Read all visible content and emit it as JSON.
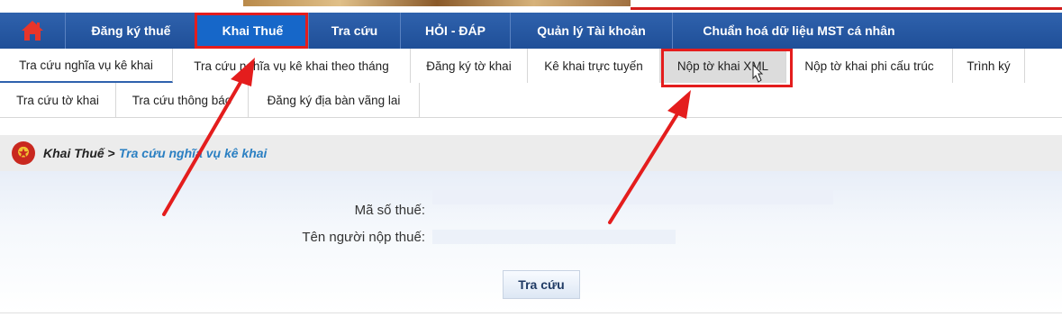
{
  "top_nav": {
    "home_icon": "home-icon",
    "items": [
      {
        "label": "Đăng ký thuế"
      },
      {
        "label": "Khai Thuế"
      },
      {
        "label": "Tra cứu"
      },
      {
        "label": "HỎI - ĐÁP"
      },
      {
        "label": "Quản lý Tài khoản"
      },
      {
        "label": "Chuẩn hoá dữ liệu MST cá nhân"
      }
    ],
    "active_index": 1
  },
  "sub_nav": {
    "row1": [
      {
        "label": "Tra cứu nghĩa vụ kê khai"
      },
      {
        "label": "Tra cứu nghĩa vụ kê khai theo tháng"
      },
      {
        "label": "Đăng ký tờ khai"
      },
      {
        "label": "Kê khai trực tuyến"
      },
      {
        "label": "Nộp tờ khai XML"
      },
      {
        "label": "Nộp tờ khai phi cấu trúc"
      },
      {
        "label": "Trình ký"
      }
    ],
    "row2": [
      {
        "label": "Tra cứu tờ khai"
      },
      {
        "label": "Tra cứu thông báo"
      },
      {
        "label": "Đăng ký địa bàn vãng lai"
      }
    ]
  },
  "breadcrumb": {
    "root": "Khai Thuế",
    "separator": ">",
    "current": "Tra cứu nghĩa vụ kê khai"
  },
  "form": {
    "tax_code_label": "Mã số thuế:",
    "taxpayer_name_label": "Tên người nộp thuế:",
    "search_button": "Tra cứu"
  },
  "colors": {
    "nav_bg": "#2f62ad",
    "nav_active": "#1667c9",
    "highlight": "#e41d1d",
    "breadcrumb_link": "#2a7fc2"
  }
}
